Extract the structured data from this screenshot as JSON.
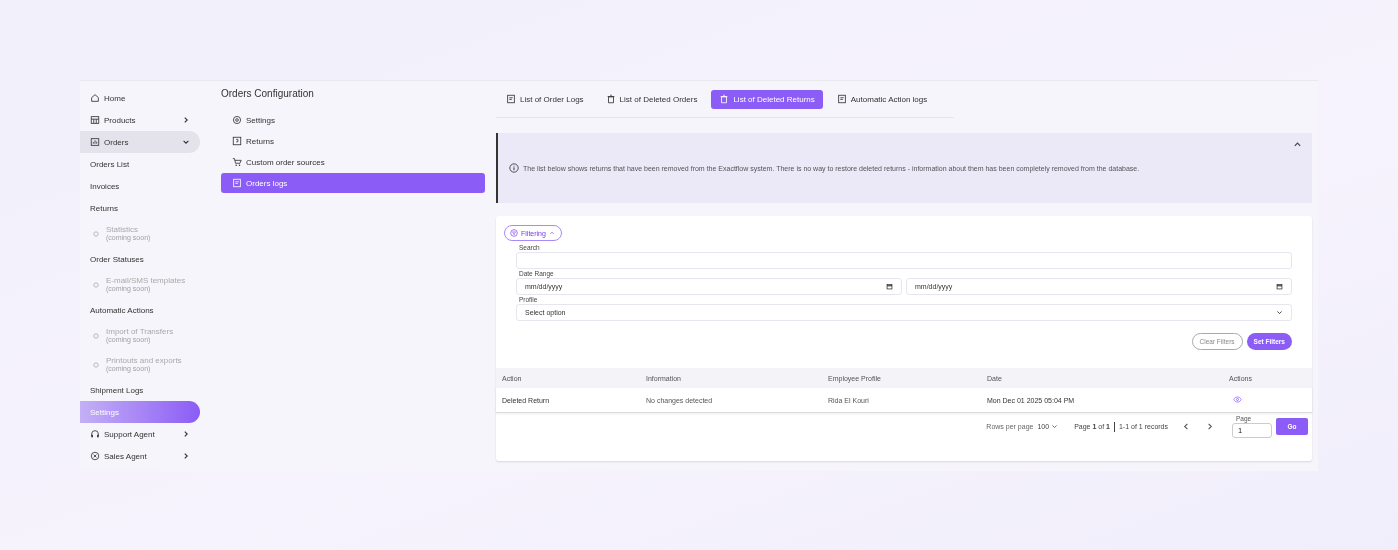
{
  "sidebar": {
    "items": [
      {
        "kind": "link",
        "label": "Home",
        "selected": false
      },
      {
        "kind": "menu",
        "label": "Products",
        "expanded": false,
        "selected": false
      },
      {
        "kind": "menu",
        "label": "Orders",
        "expanded": true,
        "selected": true
      },
      {
        "kind": "plain",
        "label": "Orders List",
        "selected": false
      },
      {
        "kind": "plain",
        "label": "Invoices",
        "selected": false
      },
      {
        "kind": "plain",
        "label": "Returns",
        "selected": false
      },
      {
        "kind": "soon",
        "label": "Statistics",
        "note": "(coming soon)"
      },
      {
        "kind": "plain",
        "label": "Order Statuses",
        "selected": false
      },
      {
        "kind": "soon",
        "label": "E-mail/SMS templates",
        "note": "(coming soon)"
      },
      {
        "kind": "plain",
        "label": "Automatic Actions",
        "selected": false
      },
      {
        "kind": "soon",
        "label": "Import of Transfers",
        "note": "(coming soon)"
      },
      {
        "kind": "soon",
        "label": "Printouts and exports",
        "note": "(coming soon)"
      },
      {
        "kind": "plain",
        "label": "Shipment Logs",
        "selected": false
      },
      {
        "kind": "plain",
        "label": "Settings",
        "selected": true
      },
      {
        "kind": "menu",
        "label": "Support Agent",
        "expanded": false,
        "selected": false
      },
      {
        "kind": "menu",
        "label": "Sales Agent",
        "expanded": false,
        "selected": false
      }
    ]
  },
  "config": {
    "title": "Orders Configuration",
    "items": [
      {
        "label": "Settings",
        "selected": false
      },
      {
        "label": "Returns",
        "selected": false
      },
      {
        "label": "Custom order sources",
        "selected": false
      },
      {
        "label": "Orders logs",
        "selected": true
      }
    ]
  },
  "tabs": [
    {
      "label": "List of Order Logs",
      "selected": false
    },
    {
      "label": "List of Deleted Orders",
      "selected": false
    },
    {
      "label": "List of Deleted Returns",
      "selected": true
    },
    {
      "label": "Automatic Action logs",
      "selected": false
    }
  ],
  "info": {
    "expanded": true,
    "text": "The list below shows returns that have been removed from the Exactflow system. There is no way to restore deleted returns - information about them has been completely removed from the database."
  },
  "filters": {
    "toggle": "Filtering",
    "expanded": true,
    "search": {
      "label": "Search"
    },
    "date_range": {
      "label": "Date Range",
      "from": "mm/dd/yyyy",
      "to": "mm/dd/yyyy"
    },
    "profile": {
      "label": "Profile",
      "value": "Select option"
    },
    "buttons": [
      "Clear Filters",
      "Set Filters"
    ]
  },
  "table": {
    "columns": [
      "Action",
      "Information",
      "Employee Profile",
      "Date",
      "Actions"
    ],
    "rows": [
      {
        "action": "Deleted Return",
        "information": "No changes detected",
        "employee": "Rida El Kouri",
        "date": "Mon Dec 01 2025 05:04 PM"
      }
    ]
  },
  "pagination": {
    "rows_label": "Rows per page",
    "rows_value": "100",
    "page_info": "Page **1** of **1**",
    "records": "1-1 of 1 records",
    "page_label": "Page",
    "page_value": "1",
    "go": "Go"
  }
}
